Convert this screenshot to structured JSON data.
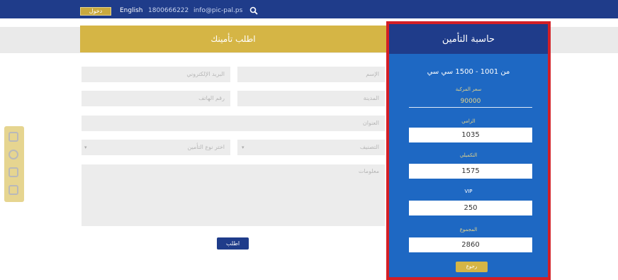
{
  "topbar": {
    "login_label": "دخول",
    "language_label": "English",
    "phone": "1800666222",
    "email": "info@pic-pal.ps"
  },
  "request": {
    "title": "اطلب تأمينك",
    "name_placeholder": "الإسم",
    "email_placeholder": "البريد الإلكتروني",
    "city_placeholder": "المدينة",
    "phone_placeholder": "رقم الهاتف",
    "address_placeholder": "العنوان",
    "category_placeholder": "التصنيف",
    "insurance_type_placeholder": "اختر نوع التأمين",
    "notes_placeholder": "معلومات",
    "submit_label": "اطلب"
  },
  "calculator": {
    "title": "حاسبة التأمين",
    "engine_range": "من 1001 - 1500 سي سي",
    "vehicle_price_label": "سعر المركبة",
    "vehicle_price": "90000",
    "basic_label": "الزامي",
    "basic_value": "1035",
    "comprehensive_label": "التكميلي",
    "comprehensive_value": "1575",
    "vip_label": "VIP",
    "vip_value": "250",
    "total_label": "المجموع",
    "total_value": "2860",
    "back_label": "رجوع"
  },
  "colors": {
    "navy": "#1f3c8a",
    "gold": "#d5b545",
    "calc_blue": "#1e68c3",
    "highlight_red": "#d31f26"
  }
}
